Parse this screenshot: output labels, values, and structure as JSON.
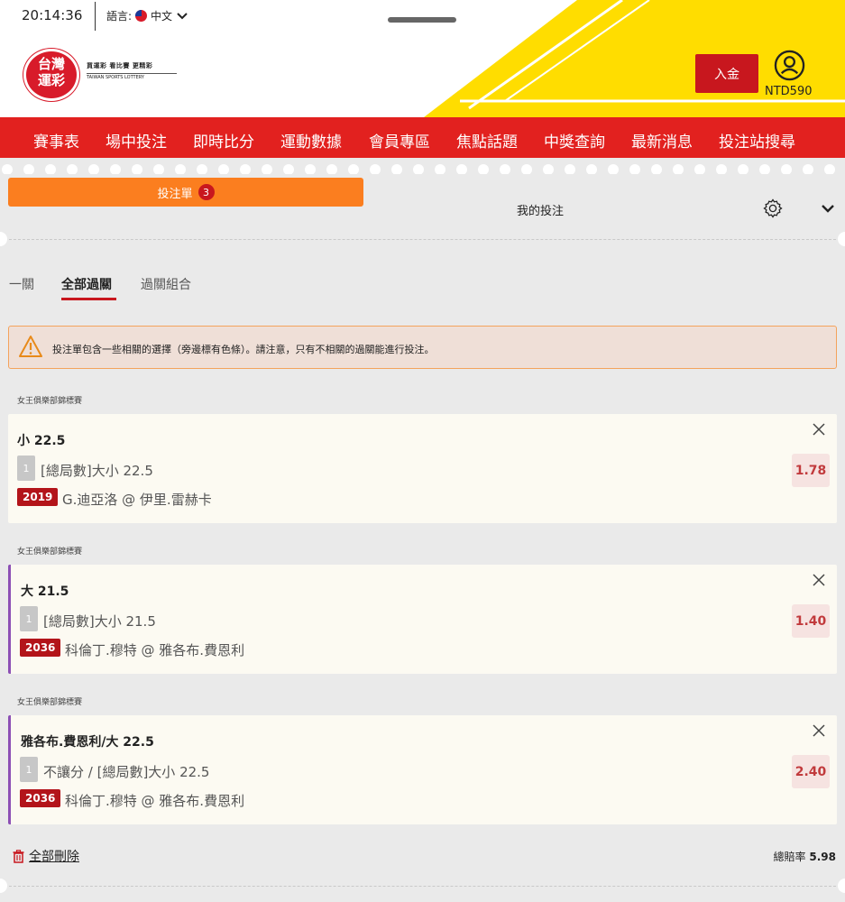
{
  "status_bar": {
    "time": "20:14:36",
    "language_label": "語言:",
    "language_value": "中文"
  },
  "brand": {
    "logo_text": "台灣\n運彩",
    "tagline": "買運彩 看比賽 更精彩",
    "subtitle": "TAIWAN SPORTS LOTTERY"
  },
  "account": {
    "deposit_label": "入金",
    "balance": "NTD590"
  },
  "nav": [
    "賽事表",
    "場中投注",
    "即時比分",
    "運動數據",
    "會員專區",
    "焦點話題",
    "中獎查詢",
    "最新消息",
    "投注站搜尋"
  ],
  "betslip": {
    "tab_betslip": "投注單",
    "tab_betslip_count": "3",
    "tab_mybets": "我的投注",
    "subtabs": [
      "一關",
      "全部過關",
      "過關組合"
    ],
    "active_subtab": "全部過關",
    "warning": "投注單包含一些相關的選擇（旁邊標有色條）。請注意，只有不相關的過關能進行投注。",
    "bets": [
      {
        "league": "女王俱樂部錦標賽",
        "pick": "小 22.5",
        "leg": "1",
        "market": "[總局數]大小 22.5",
        "code": "2019",
        "match": "G.迪亞洛 @ 伊里.雷赫卡",
        "odds": "1.78"
      },
      {
        "league": "女王俱樂部錦標賽",
        "pick": "大 21.5",
        "leg": "1",
        "market": "[總局數]大小 21.5",
        "code": "2036",
        "match": "科倫丁.穆特 @ 雅各布.費恩利",
        "odds": "1.40"
      },
      {
        "league": "女王俱樂部錦標賽",
        "pick": "雅各布.費恩利/大 22.5",
        "leg": "1",
        "market": "不讓分 / [總局數]大小 22.5",
        "code": "2036",
        "match": "科倫丁.穆特 @ 雅各布.費恩利",
        "odds": "2.40"
      }
    ],
    "delete_all": "全部刪除",
    "total_odds_label": "總賠率",
    "total_odds_value": "5.98"
  },
  "colors": {
    "brand_red": "#e2211f",
    "orange": "#fb7e1f",
    "yellow": "#ffdd00",
    "linked_bar": "#8c4fb5"
  }
}
